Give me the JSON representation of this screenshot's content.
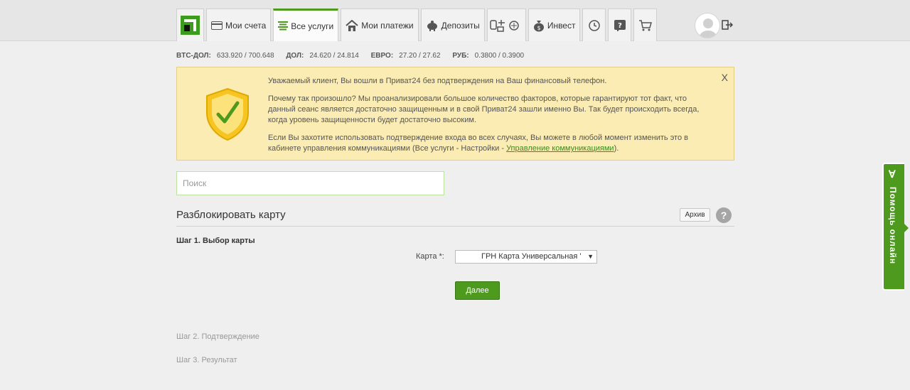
{
  "nav": {
    "items": [
      {
        "label": "Мои счета",
        "icon": "card-icon"
      },
      {
        "label": "Все услуги",
        "icon": "list-icon",
        "active": true
      },
      {
        "label": "Мои платежи",
        "icon": "home-icon"
      },
      {
        "label": "Депозиты",
        "icon": "piggy-bank-icon"
      },
      {
        "label": "",
        "icon": "travel-icon"
      },
      {
        "label": "Инвест",
        "icon": "money-bag-icon"
      },
      {
        "label": "",
        "icon": "history-icon"
      },
      {
        "label": "",
        "icon": "help-icon"
      },
      {
        "label": "",
        "icon": "cart-icon"
      }
    ]
  },
  "rates": [
    {
      "label": "BTC-ДОЛ:",
      "value": "633.920 / 700.648"
    },
    {
      "label": "ДОЛ:",
      "value": "24.620 / 24.814"
    },
    {
      "label": "ЕВРО:",
      "value": "27.20 / 27.62"
    },
    {
      "label": "РУБ:",
      "value": "0.3800 / 0.3900"
    }
  ],
  "notice": {
    "close": "X",
    "p1": "Уважаемый клиент, Вы вошли в Приват24 без подтверждения на Ваш финансовый телефон.",
    "p2": "Почему так произошло? Мы проанализировали большое количество факторов, которые гарантируют тот факт, что данный сеанс является достаточно защищенным и в свой Приват24 зашли именно Вы. Так будет происходить всегда, когда уровень защищенности будет достаточно высоким.",
    "p3_before": "Если Вы захотите использовать подтверждение входа во всех случаях, Вы можете в любой момент изменить это в кабинете управления коммуникациями (Все услуги - Настройки - ",
    "p3_link": "Управление коммуникациями",
    "p3_after": ")."
  },
  "search": {
    "placeholder": "Поиск"
  },
  "section": {
    "title": "Разблокировать карту",
    "archive": "Архив",
    "help": "?"
  },
  "steps": {
    "step1": "Шаг 1. Выбор карты",
    "card_label": "Карта *:",
    "card_value": "ГРН  Карта Универсальная '",
    "next": "Далее",
    "step2": "Шаг 2. Подтверждение",
    "step3": "Шаг 3. Результат"
  },
  "help_tab": {
    "label": "Помощь онлайн"
  },
  "colors": {
    "accent": "#4e9a1f",
    "notice_bg": "#fbecb3"
  }
}
